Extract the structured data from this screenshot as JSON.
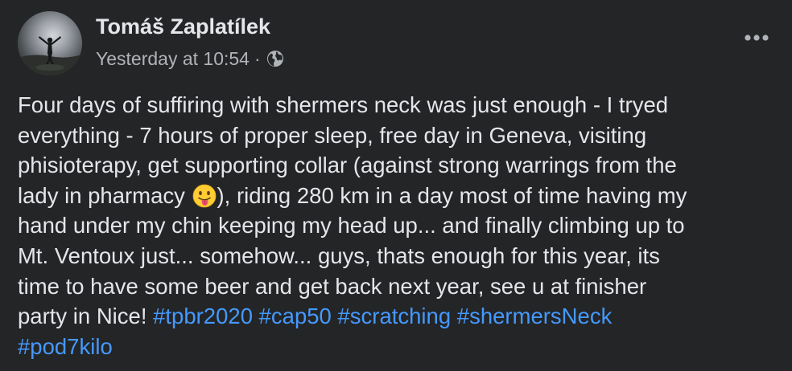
{
  "post": {
    "author": "Tomáš Zaplatílek",
    "timestamp": "Yesterday at 10:54",
    "separator": "·",
    "audience_icon": "globe-icon",
    "more_icon": "more-horizontal-icon",
    "emoji_icon": "face-with-tongue-emoji",
    "text_lines": [
      "Four days of suffiring with shermers neck was just enough - I tryed",
      "everything - 7 hours of proper sleep, free day in Geneva, visiting",
      "phisioterapy, get supporting collar (against strong warrings from the",
      "lady in pharmacy",
      "), riding 280 km in a day most of time having my",
      "hand under my chin keeping my head up... and finally climbing up to",
      "Mt. Ventoux just... somehow... guys, thats enough for this year, its",
      "time to have some beer and get back next year, see u at finisher",
      "party in Nice! "
    ],
    "hashtags": [
      "#tpbr2020",
      "#cap50",
      "#scratching",
      "#shermersNeck",
      "#pod7kilo"
    ],
    "colors": {
      "background": "#242526",
      "primary_text": "#e4e6eb",
      "secondary_text": "#b0b3b8",
      "link": "#4599ff"
    }
  }
}
